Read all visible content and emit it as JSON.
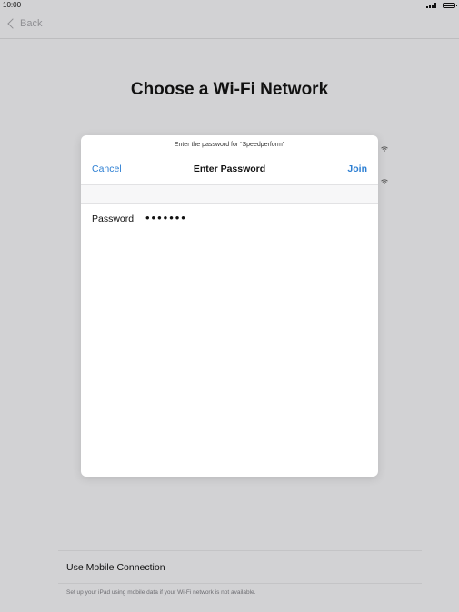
{
  "status_bar": {
    "time": "10:00",
    "signal_icon": "signal-icon",
    "battery_icon": "battery-icon"
  },
  "nav": {
    "back_label": "Back",
    "back_icon": "chevron-left-icon"
  },
  "page": {
    "title": "Choose a Wi-Fi Network"
  },
  "networks_visible": 2,
  "modal": {
    "prompt": "Enter the password for “Speedperform”",
    "cancel_label": "Cancel",
    "title": "Enter Password",
    "join_label": "Join",
    "password_label": "Password",
    "password_value": "•••••••"
  },
  "bottom": {
    "mobile_label": "Use Mobile Connection",
    "note": "Set up your iPad using mobile data if your Wi-Fi network is not available."
  },
  "colors": {
    "accent": "#2d7fd3",
    "background": "#d2d2d4"
  }
}
